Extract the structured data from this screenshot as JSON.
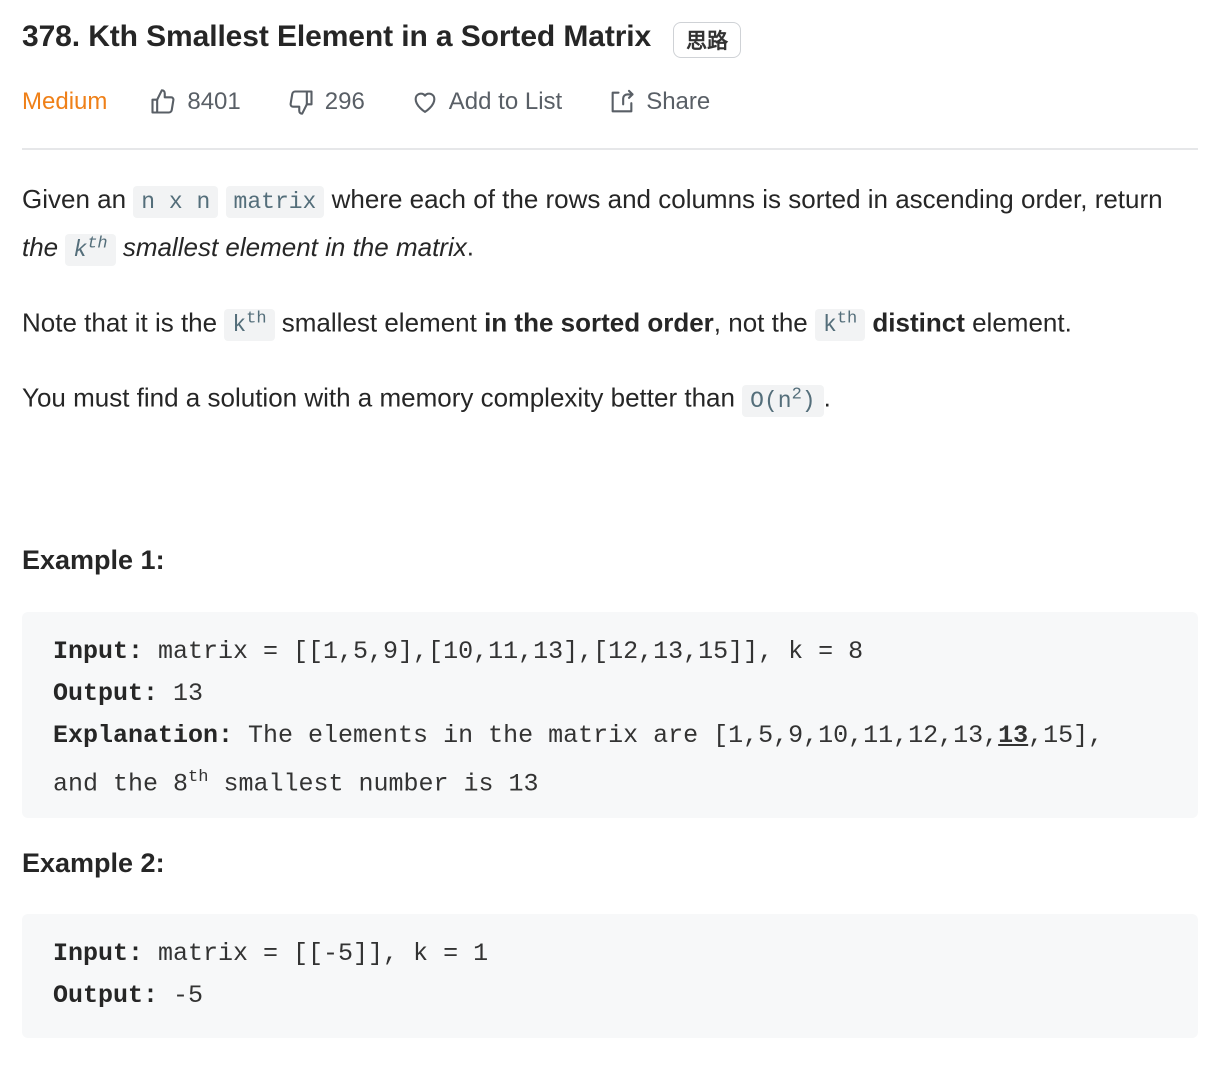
{
  "problem": {
    "number_title": "378. Kth Smallest Element in a Sorted Matrix",
    "hint_label": "思路",
    "difficulty": "Medium",
    "likes": "8401",
    "dislikes": "296",
    "add_to_list": "Add to List",
    "share": "Share"
  },
  "description": {
    "p1": {
      "t1": "Given an ",
      "c1": "n x n",
      "c2": "matrix",
      "t2": " where each of the rows and columns is sorted in ascending order, return ",
      "t3": "the ",
      "k": "k",
      "th": "th",
      "t4": " smallest element in the matrix",
      "t5": "."
    },
    "p2": {
      "t1": "Note that it is the ",
      "k": "k",
      "th": "th",
      "t2": " smallest element ",
      "b1": "in the sorted order",
      "t3": ", not the ",
      "b2": "distinct",
      "t4": " element."
    },
    "p3": {
      "t1": "You must find a solution with a memory complexity better than ",
      "c1": "O(n",
      "sup": "2",
      "c2": ")",
      "t2": "."
    }
  },
  "examples": [
    {
      "title": "Example 1:",
      "input_label": "Input:",
      "input_value": " matrix = [[1,5,9],[10,11,13],[12,13,15]], k = 8",
      "output_label": "Output:",
      "output_value": " 13",
      "explanation_label": "Explanation:",
      "explanation_pre": " The elements in the matrix are [1,5,9,10,11,12,13,",
      "explanation_highlight": "13",
      "explanation_post": ",15],",
      "explanation_line2_pre": "and the 8",
      "explanation_line2_sup": "th",
      "explanation_line2_post": " smallest number is 13"
    },
    {
      "title": "Example 2:",
      "input_label": "Input:",
      "input_value": " matrix = [[-5]], k = 1",
      "output_label": "Output:",
      "output_value": " -5"
    }
  ],
  "icons": {
    "like": "thumbs-up-icon",
    "dislike": "thumbs-down-icon",
    "add_to_list": "heart-icon",
    "share": "share-icon"
  },
  "colors": {
    "difficulty_medium": "#ef8018",
    "code_bg": "#f2f3f4",
    "example_bg": "#f7f8f9"
  }
}
